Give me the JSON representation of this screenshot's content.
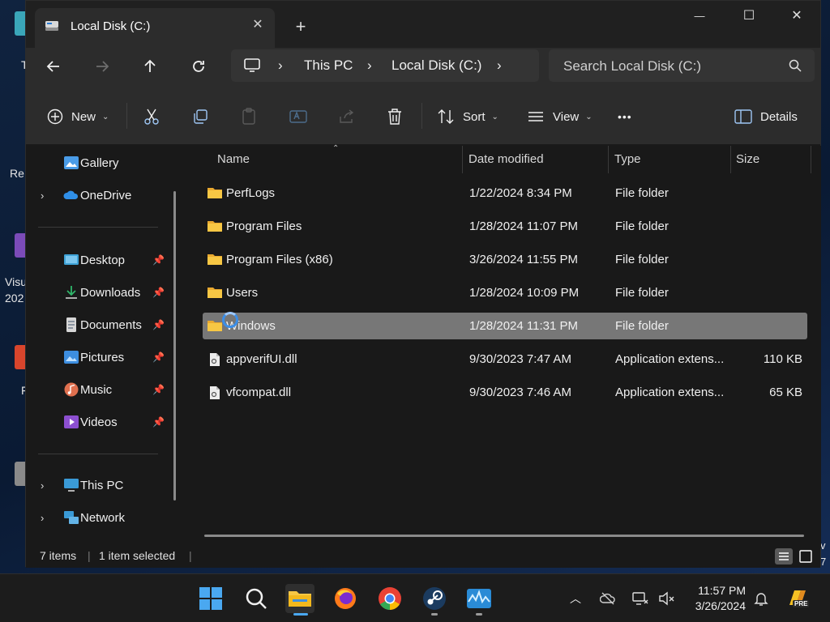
{
  "desktop": {
    "label_frag_1": "T",
    "label_frag_2": "Re",
    "label_frag_3": "Visu",
    "label_frag_4": "202",
    "label_frag_5": "F",
    "label_frag_6": "v",
    "label_frag_7": "7"
  },
  "window": {
    "tab_title": "Local Disk (C:)",
    "new_tab": "+",
    "close_tab": "✕",
    "minimize": "—",
    "maximize": "☐",
    "close": "✕"
  },
  "navbar": {
    "breadcrumb": [
      "This PC",
      "Local Disk (C:)"
    ],
    "search_placeholder": "Search Local Disk (C:)"
  },
  "toolbar": {
    "new_label": "New",
    "sort_label": "Sort",
    "view_label": "View",
    "more_label": "•••",
    "details_label": "Details"
  },
  "sidebar": {
    "gallery": "Gallery",
    "onedrive": "OneDrive",
    "desktop": "Desktop",
    "downloads": "Downloads",
    "documents": "Documents",
    "pictures": "Pictures",
    "music": "Music",
    "videos": "Videos",
    "this_pc": "This PC",
    "network": "Network"
  },
  "columns": {
    "name": "Name",
    "date": "Date modified",
    "type": "Type",
    "size": "Size"
  },
  "files": [
    {
      "name": "PerfLogs",
      "date": "1/22/2024 8:34 PM",
      "type": "File folder",
      "size": "",
      "kind": "folder"
    },
    {
      "name": "Program Files",
      "date": "1/28/2024 11:07 PM",
      "type": "File folder",
      "size": "",
      "kind": "folder"
    },
    {
      "name": "Program Files (x86)",
      "date": "3/26/2024 11:55 PM",
      "type": "File folder",
      "size": "",
      "kind": "folder"
    },
    {
      "name": "Users",
      "date": "1/28/2024 10:09 PM",
      "type": "File folder",
      "size": "",
      "kind": "folder"
    },
    {
      "name": "Windows",
      "date": "1/28/2024 11:31 PM",
      "type": "File folder",
      "size": "",
      "kind": "folder",
      "selected": true
    },
    {
      "name": "appverifUI.dll",
      "date": "9/30/2023 7:47 AM",
      "type": "Application extens...",
      "size": "110 KB",
      "kind": "dll"
    },
    {
      "name": "vfcompat.dll",
      "date": "9/30/2023 7:46 AM",
      "type": "Application extens...",
      "size": "65 KB",
      "kind": "dll"
    }
  ],
  "status": {
    "items": "7 items",
    "selected": "1 item selected"
  },
  "taskbar": {
    "time": "11:57 PM",
    "date": "3/26/2024",
    "badge": "PRE"
  },
  "colors": {
    "window_bg": "#191919",
    "toolbar_bg": "#2c2c2c",
    "selected_row": "#777777",
    "folder_yellow": "#f7c744",
    "accent_blue": "#3b8ee8"
  }
}
